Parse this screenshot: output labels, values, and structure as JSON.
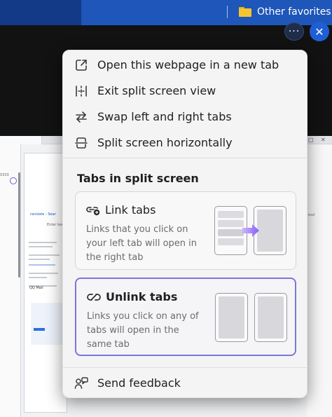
{
  "favorites_bar": {
    "other_favorites": "Other favorites",
    "folder_icon": "folder-icon"
  },
  "top_buttons": {
    "more_label": "···",
    "close_label": "✕"
  },
  "background_page": {
    "left_number": "0333",
    "search_snippet": "ranslate - Sear",
    "enter_text": "Enter tex",
    "right_snippet": "read",
    "mail_label": "QQ Mail"
  },
  "menu": {
    "items": [
      {
        "label": "Open this webpage in a new tab",
        "icon": "open-in-new-tab-icon"
      },
      {
        "label": "Exit split screen view",
        "icon": "exit-split-screen-icon"
      },
      {
        "label": "Swap left and right tabs",
        "icon": "swap-arrows-icon"
      },
      {
        "label": "Split screen horizontally",
        "icon": "split-horizontal-icon"
      }
    ],
    "section_heading": "Tabs in split screen",
    "link_tabs": {
      "title": "Link tabs",
      "description": "Links that you click on your left tab will open in the right tab",
      "selected": false
    },
    "unlink_tabs": {
      "title": "Unlink tabs",
      "description": "Links you click on any of tabs will open in the same tab",
      "selected": true
    },
    "feedback": {
      "label": "Send feedback",
      "icon": "feedback-icon"
    }
  },
  "colors": {
    "favorites_bar": "#1e56b9",
    "menu_background": "#f4f4f5",
    "selected_border": "#7d76d8",
    "accent_arrow": "#8b5cf6",
    "close_button": "#1f5fd6"
  }
}
